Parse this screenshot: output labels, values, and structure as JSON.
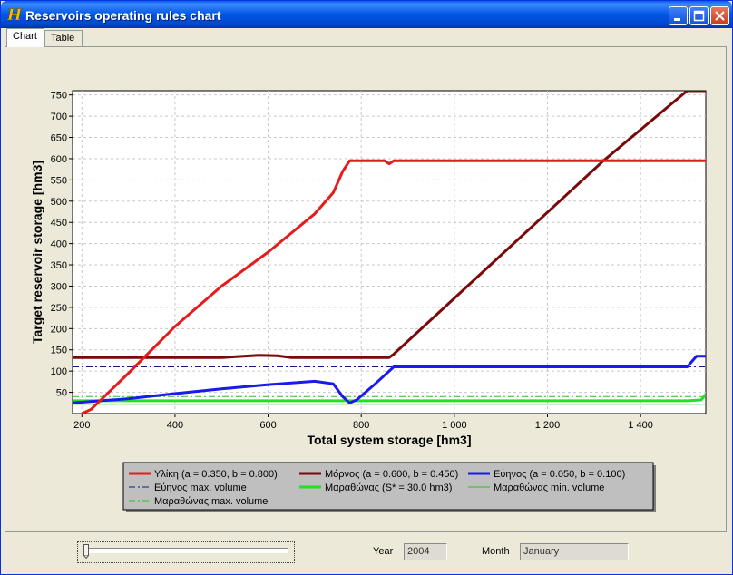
{
  "window": {
    "title": "Reservoirs operating rules chart"
  },
  "tabs": [
    {
      "label": "Chart",
      "active": true
    },
    {
      "label": "Table",
      "active": false
    }
  ],
  "bottom": {
    "year_label": "Year",
    "year_value": "2004",
    "month_label": "Month",
    "month_value": "January",
    "slider_fraction": 0.0
  },
  "colors": {
    "ylikh": "#e51c1c",
    "mornos": "#7a0a0a",
    "evinos": "#1a1aee",
    "evinos_max": "#0a1a8a",
    "marathonas": "#22e022",
    "marathonas_min": "#22c422",
    "marathonas_max": "#22c422"
  },
  "chart_data": {
    "type": "line",
    "title": "",
    "xlabel": "Total system storage [hm3]",
    "ylabel": "Target reservoir storage [hm3]",
    "xlim": [
      180,
      1540
    ],
    "ylim": [
      0,
      760
    ],
    "xticks": [
      200,
      400,
      600,
      800,
      1000,
      1200,
      1400
    ],
    "xtick_labels": [
      "200",
      "400",
      "600",
      "800",
      "1 000",
      "1 200",
      "1 400"
    ],
    "yticks": [
      50,
      100,
      150,
      200,
      250,
      300,
      350,
      400,
      450,
      500,
      550,
      600,
      650,
      700,
      750
    ],
    "ytick_labels": [
      "50",
      "100",
      "150",
      "200",
      "250",
      "300",
      "350",
      "400",
      "450",
      "500",
      "550",
      "600",
      "650",
      "700",
      "750"
    ],
    "grid": true,
    "legend_position": "bottom",
    "series": [
      {
        "name": "Υλίκη (a = 0.350, b = 0.800)",
        "color_key": "ylikh",
        "dash": "solid",
        "width": 3,
        "x": [
          200,
          220,
          300,
          400,
          500,
          600,
          700,
          740,
          760,
          775,
          790,
          850,
          860,
          870,
          1540
        ],
        "y": [
          0,
          10,
          95,
          205,
          300,
          380,
          470,
          520,
          570,
          595,
          595,
          595,
          588,
          595,
          595
        ]
      },
      {
        "name": "Μόρνος (a = 0.600, b = 0.450)",
        "color_key": "mornos",
        "dash": "solid",
        "width": 3,
        "x": [
          180,
          500,
          580,
          620,
          650,
          860,
          870,
          1320,
          1500,
          1540
        ],
        "y": [
          132,
          132,
          137,
          136,
          132,
          132,
          140,
          595,
          760,
          760
        ]
      },
      {
        "name": "Εύηνος (a = 0.050, b = 0.100)",
        "color_key": "evinos",
        "dash": "solid",
        "width": 3,
        "x": [
          180,
          300,
          400,
          500,
          600,
          700,
          740,
          760,
          775,
          790,
          830,
          870,
          1500,
          1520,
          1540
        ],
        "y": [
          25,
          35,
          47,
          58,
          68,
          76,
          70,
          40,
          25,
          32,
          70,
          110,
          110,
          135,
          135
        ]
      },
      {
        "name": "Εύηνος max. volume",
        "color_key": "evinos_max",
        "dash": "dashdot",
        "width": 1,
        "x": [
          180,
          1540
        ],
        "y": [
          110,
          110
        ]
      },
      {
        "name": "Μαραθώνας (S* = 30.0 hm3)",
        "color_key": "marathonas",
        "dash": "solid",
        "width": 3,
        "x": [
          180,
          1500,
          1530,
          1540
        ],
        "y": [
          30,
          30,
          32,
          45
        ]
      },
      {
        "name": "Μαραθώνας min. volume",
        "color_key": "marathonas_min",
        "dash": "solid",
        "width": 1,
        "x": [
          180,
          1540
        ],
        "y": [
          22,
          22
        ]
      },
      {
        "name": "Μαραθώνας max. volume",
        "color_key": "marathonas_max",
        "dash": "dashdot",
        "width": 1,
        "x": [
          180,
          1540
        ],
        "y": [
          40,
          40
        ]
      }
    ]
  }
}
